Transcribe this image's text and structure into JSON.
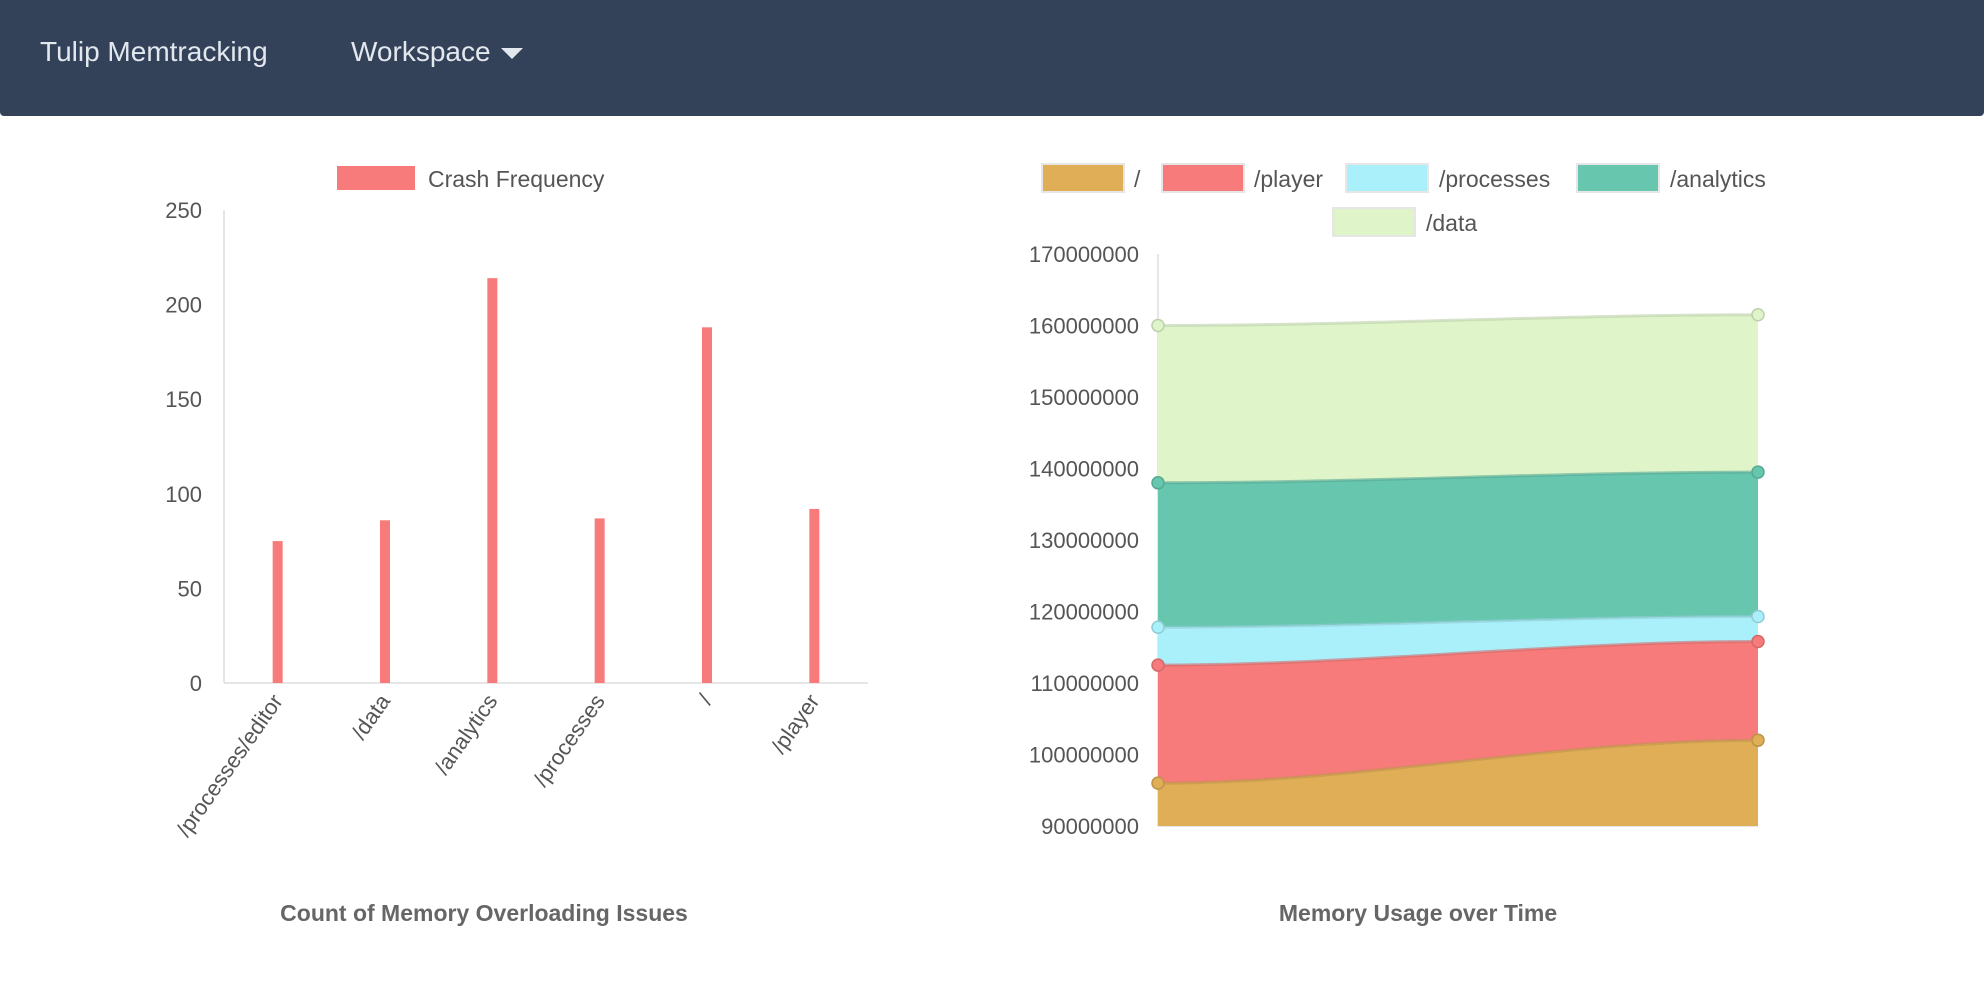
{
  "navbar": {
    "brand": "Tulip Memtracking",
    "workspace_label": "Workspace"
  },
  "colors": {
    "navbar": "#334259",
    "bar": "#f77b7b",
    "root": "#dfae56",
    "player": "#f77b7b",
    "processes": "#aaf0fb",
    "analytics": "#66c7ae",
    "data": "#dff5c9"
  },
  "bar_chart": {
    "caption": "Count of Memory Overloading Issues"
  },
  "area_chart": {
    "caption": "Memory Usage over Time"
  },
  "chart_data": [
    {
      "type": "bar",
      "categories": [
        "/processes/editor",
        "/data",
        "/analytics",
        "/processes",
        "/",
        "/player"
      ],
      "series": [
        {
          "name": "Crash Frequency",
          "values": [
            75,
            86,
            214,
            87,
            188,
            92
          ]
        }
      ],
      "title": "Count of Memory Overloading Issues",
      "ylim": [
        0,
        250
      ],
      "yticks": [
        "0",
        "50",
        "100",
        "150",
        "200",
        "250"
      ],
      "legend": "top",
      "grid": false
    },
    {
      "type": "area",
      "stacked": true,
      "x": [
        "",
        ""
      ],
      "series": [
        {
          "name": "/",
          "values": [
            96000000,
            102000000
          ]
        },
        {
          "name": "/player",
          "values": [
            112500000,
            115800000
          ]
        },
        {
          "name": "/processes",
          "values": [
            117800000,
            119300000
          ]
        },
        {
          "name": "/analytics",
          "values": [
            138000000,
            139500000
          ]
        },
        {
          "name": "/data",
          "values": [
            160000000,
            161500000
          ]
        }
      ],
      "title": "Memory Usage over Time",
      "ylim": [
        90000000,
        170000000
      ],
      "yticks": [
        "90000000",
        "100000000",
        "110000000",
        "120000000",
        "130000000",
        "140000000",
        "150000000",
        "160000000",
        "170000000"
      ],
      "legend": "top",
      "grid": false
    }
  ]
}
